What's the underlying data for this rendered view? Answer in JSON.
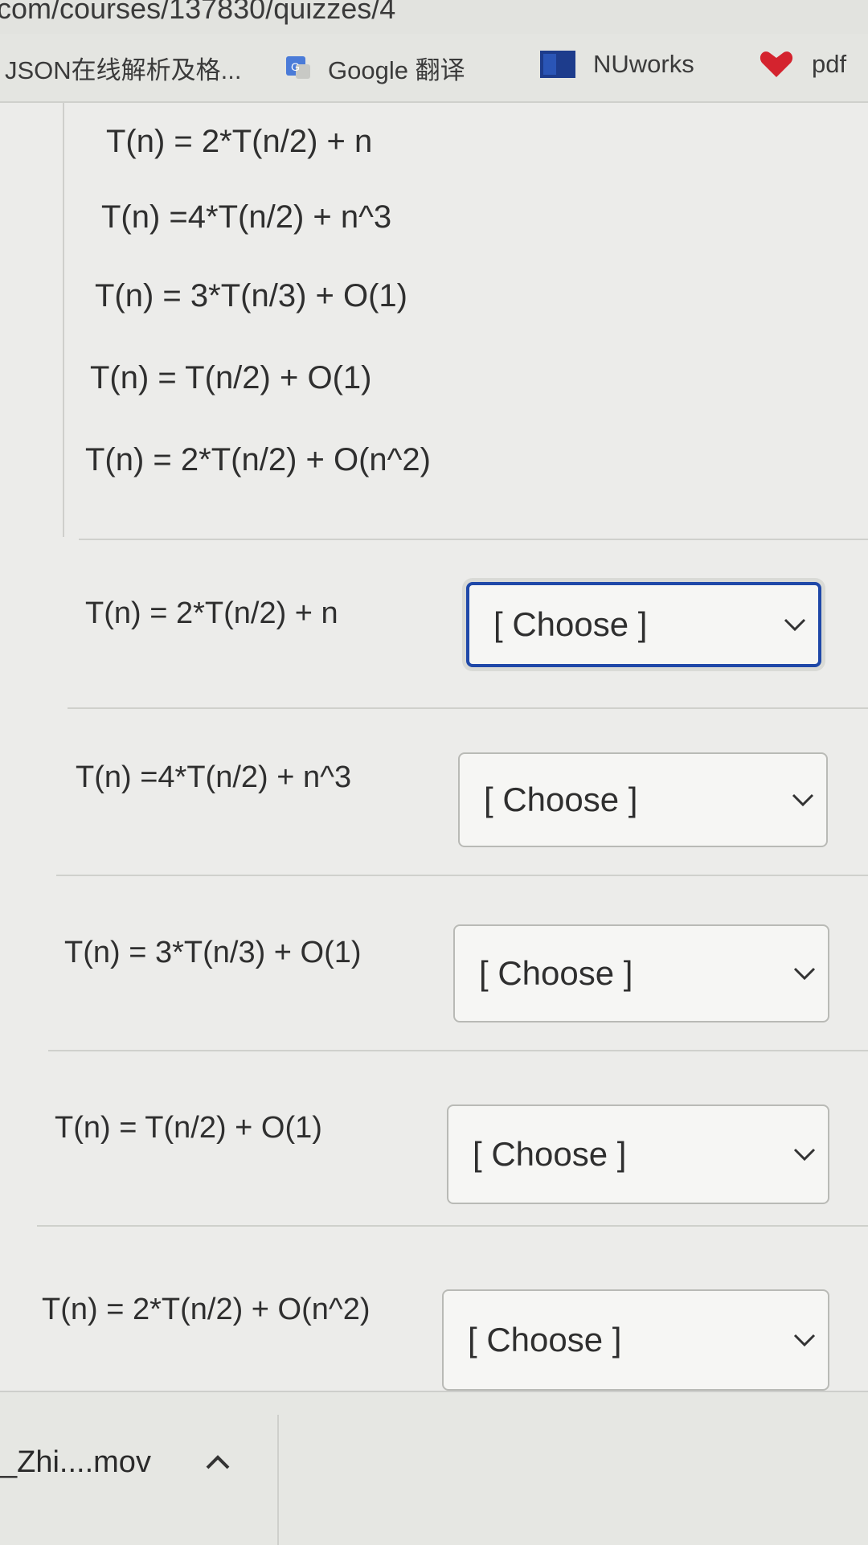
{
  "browser": {
    "url": "com/courses/137830/quizzes/4",
    "bookmarks": [
      {
        "label": "JSON在线解析及格...",
        "icon": "none"
      },
      {
        "label": "Google 翻译",
        "icon": "google-translate-icon"
      },
      {
        "label": "NUworks",
        "icon": "nuworks-icon"
      },
      {
        "label": "pdf",
        "icon": "heart-icon"
      }
    ]
  },
  "question": {
    "answer_options": [
      "T(n) = 2*T(n/2) + n",
      "T(n) =4*T(n/2) + n^3",
      "T(n) = 3*T(n/3) + O(1)",
      "T(n) = T(n/2) + O(1)",
      "T(n) = 2*T(n/2) + O(n^2)"
    ],
    "matches": [
      {
        "label": "T(n) = 2*T(n/2) + n",
        "selected": "[ Choose ]"
      },
      {
        "label": "T(n) =4*T(n/2) + n^3",
        "selected": "[ Choose ]"
      },
      {
        "label": "T(n) = 3*T(n/3) + O(1)",
        "selected": "[ Choose ]"
      },
      {
        "label": "T(n) = T(n/2) + O(1)",
        "selected": "[ Choose ]"
      },
      {
        "label": "T(n) = 2*T(n/2) + O(n^2)",
        "selected": "[ Choose ]"
      }
    ]
  },
  "download_bar": {
    "file_name": "_Zhi....mov"
  },
  "colors": {
    "focus_border": "#1f48a8",
    "background": "#ececea"
  }
}
